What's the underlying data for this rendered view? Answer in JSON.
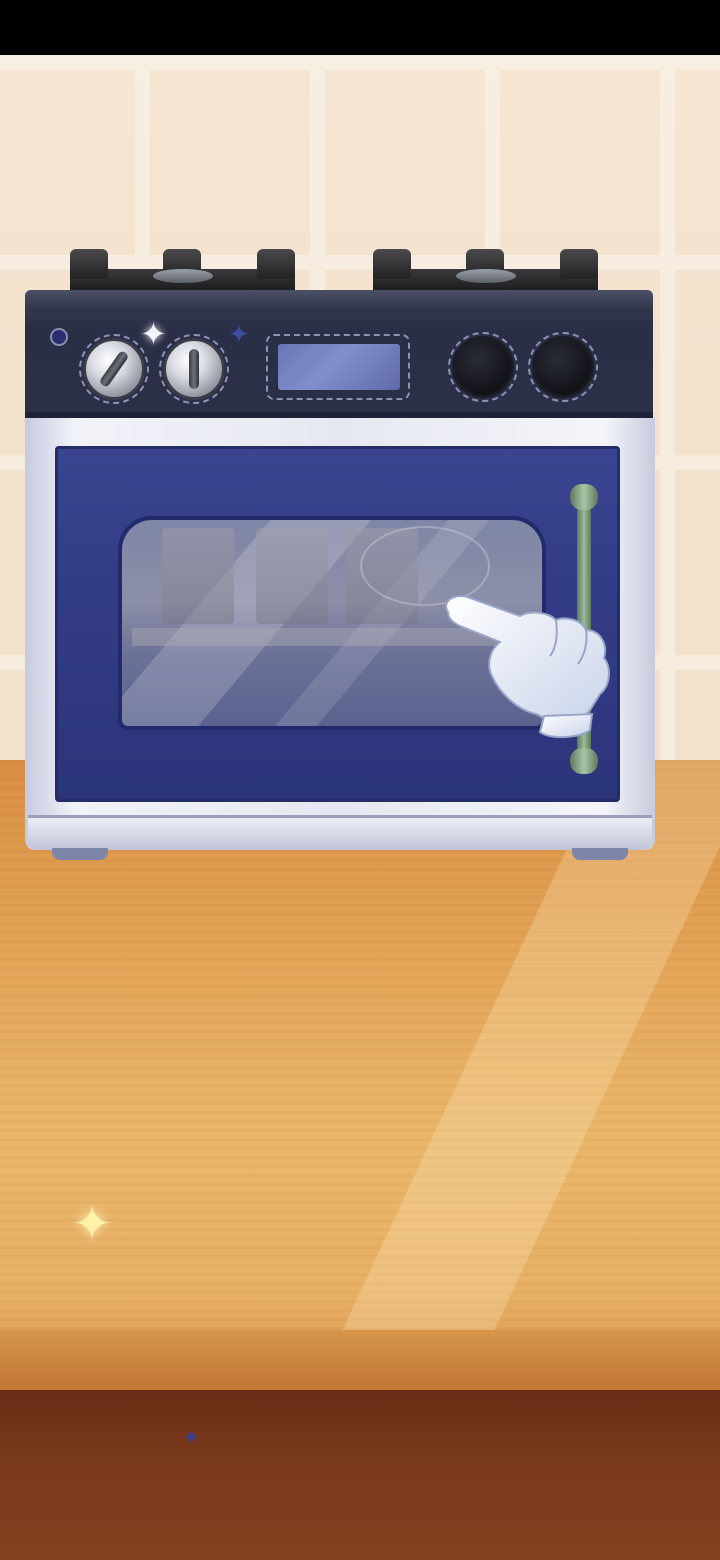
{
  "scene": {
    "name": "kitchen oven",
    "colors": {
      "wall": "#f3e2cb",
      "counter": "#e3a457",
      "counter_front": "#7a3a1c",
      "oven_panel": "#2b3049",
      "oven_door": "#333c86",
      "oven_body": "#e6e8f1",
      "handle": "#9cba98"
    }
  },
  "stove": {
    "burners": [
      "left-burner",
      "right-burner"
    ],
    "knobs": [
      {
        "id": "knob-1",
        "style": "silver"
      },
      {
        "id": "knob-2",
        "style": "silver"
      },
      {
        "id": "knob-3",
        "style": "dark"
      },
      {
        "id": "knob-4",
        "style": "dark"
      }
    ],
    "display": {
      "icon": "display-panel"
    }
  },
  "oven": {
    "door": {
      "icon": "oven-door"
    },
    "handle": {
      "icon": "door-handle"
    },
    "window": {
      "icon": "oven-window"
    }
  },
  "tutorial": {
    "hint_icon": "pointing-hand-icon"
  },
  "sparkles": [
    "sparkle-icon",
    "sparkle-icon",
    "sparkle-icon"
  ]
}
